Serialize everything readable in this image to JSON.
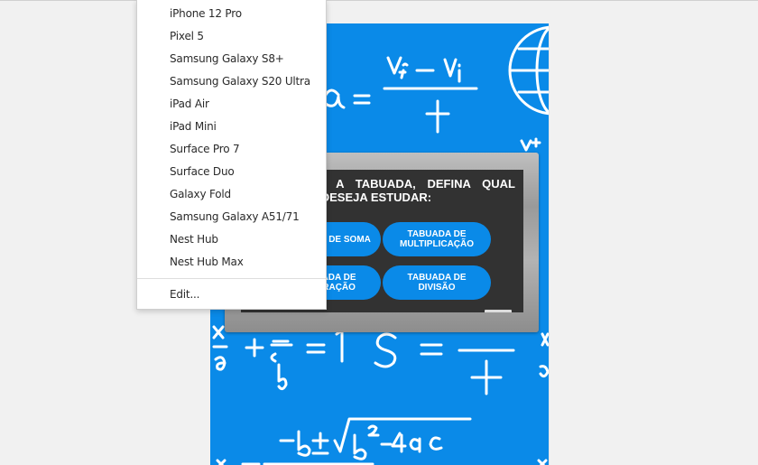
{
  "device_menu": {
    "items": [
      "iPhone 12 Pro",
      "Pixel 5",
      "Samsung Galaxy S8+",
      "Samsung Galaxy S20 Ultra",
      "iPad Air",
      "iPad Mini",
      "Surface Pro 7",
      "Surface Duo",
      "Galaxy Fold",
      "Samsung Galaxy A51/71",
      "Nest Hub",
      "Nest Hub Max"
    ],
    "edit_label": "Edit..."
  },
  "page": {
    "background_color": "#0a8ae8",
    "heading": "BEM VINDO A TABUADA, DEFINA QUAL OPERAÇÃO DESEJA ESTUDAR:",
    "buttons": {
      "soma": "TABUADA DE SOMA",
      "multiplicacao": "TABUADA DE MULTIPLICAÇÃO",
      "subtracao": "TABUADA DE SUBTRAÇÃO",
      "divisao": "TABUADA DE DIVISÃO"
    },
    "formulas": {
      "acceleration": "a = (Vf − Vi) / t",
      "fraction": "a/b = 1",
      "quadratic": "−b ± √(b²−4ac)"
    }
  }
}
